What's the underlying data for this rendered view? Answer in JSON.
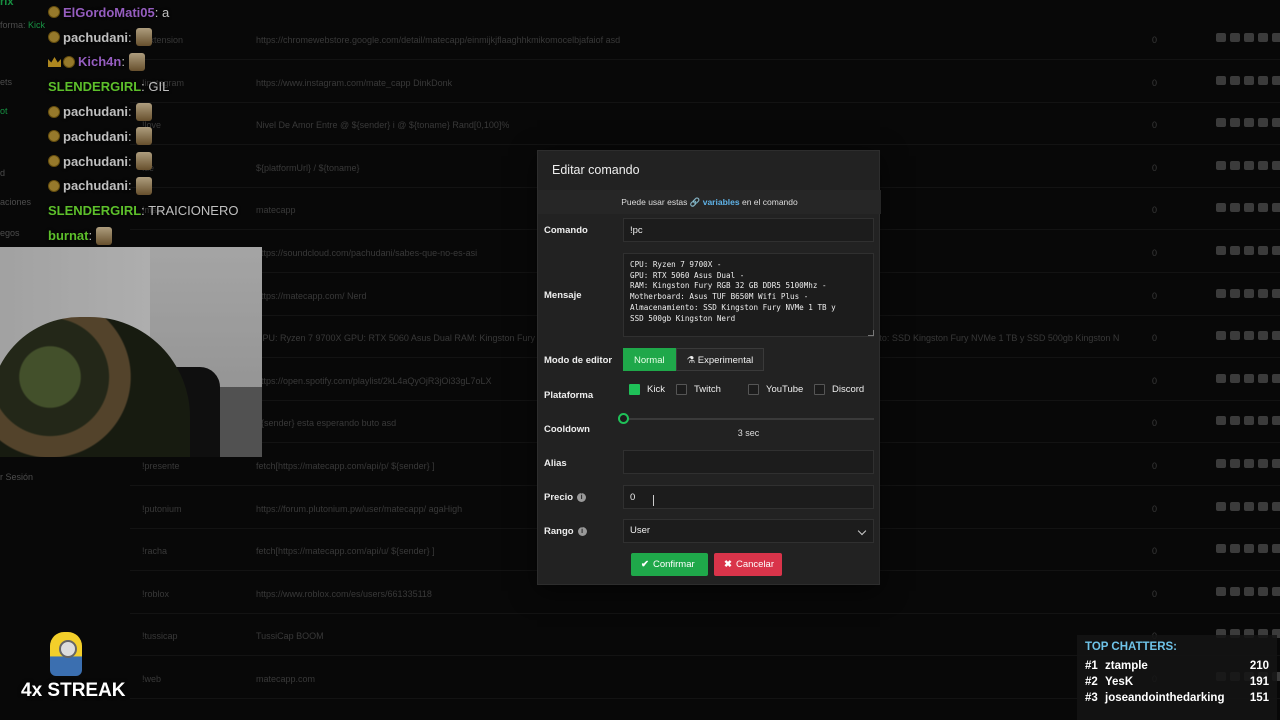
{
  "sidebar": {
    "fragments": [
      "rix",
      "forma:",
      "Kick",
      "ets",
      "ot",
      "d",
      "aciones",
      "egos",
      "r Sesión"
    ]
  },
  "commands": [
    {
      "name": "!extension",
      "message": "https://chromewebstore.google.com/detail/matecapp/einmijkjflaaghhkmikomocelbjafaiof asd",
      "count": "0"
    },
    {
      "name": "!instagram",
      "message": "https://www.instagram.com/mate_capp DinkDonk",
      "count": "0"
    },
    {
      "name": "!love",
      "message": "Nivel De Amor Entre @ ${sender} i @ ${toname} Rand[0,100]%",
      "count": "0"
    },
    {
      "name": "!tle",
      "message": "${platformUrl} / ${toname}",
      "count": "0"
    },
    {
      "name": "!mate",
      "message": "matecapp",
      "count": "0"
    },
    {
      "name": "!sc",
      "message": "https://soundcloud.com/pachudani/sabes-que-no-es-asi",
      "count": "0"
    },
    {
      "name": "!web",
      "message": "https://matecapp.com/ Nerd",
      "count": "0"
    },
    {
      "name": "!pc",
      "message": "CPU: Ryzen 7 9700X GPU: RTX 5060 Asus Dual RAM: Kingston Fury RGB 32 GB DDR5 5100Mhz Motherboard: Asus TUF B650M Wifi Plus Almacenamiento: SSD Kingston Fury NVMe 1 TB y SSD 500gb Kingston N",
      "count": "0"
    },
    {
      "name": "!spotify",
      "message": "https://open.spotify.com/playlist/2kL4aQyOjR3jOi33gL7oLX",
      "count": "0"
    },
    {
      "name": "!buto",
      "message": "${sender} esta esperando buto asd",
      "count": "0"
    },
    {
      "name": "!presente",
      "message": "fetch[https://matecapp.com/api/p/ ${sender} ]",
      "count": "0"
    },
    {
      "name": "!putonium",
      "message": "https://forum.plutonium.pw/user/matecapp/ agaHigh",
      "count": "0"
    },
    {
      "name": "!racha",
      "message": "fetch[https://matecapp.com/api/u/ ${sender} ]",
      "count": "0"
    },
    {
      "name": "!roblox",
      "message": "https://www.roblox.com/es/users/661335118",
      "count": "0"
    },
    {
      "name": "!tussicap",
      "message": "TussiCap BOOM",
      "count": "0"
    },
    {
      "name": "!web",
      "message": "matecapp.com",
      "count": "0"
    }
  ],
  "chat": [
    {
      "user": "ElGordoMati05",
      "color": "#c77dff",
      "message": ": a",
      "badge": "coin",
      "emote": false
    },
    {
      "user": "pachudani",
      "color": "#ffffff",
      "message": ":",
      "badge": "coin",
      "emote": true
    },
    {
      "user": "Kich4n",
      "color": "#c77dff",
      "message": ":",
      "badge": "crown",
      "emote": true
    },
    {
      "user": "SLENDERGIRL",
      "color": "#7cff3a",
      "message": ": GIL",
      "badge": "none",
      "emote": false
    },
    {
      "user": "pachudani",
      "color": "#ffffff",
      "message": ":",
      "badge": "coin",
      "emote": true
    },
    {
      "user": "pachudani",
      "color": "#ffffff",
      "message": ":",
      "badge": "coin",
      "emote": true
    },
    {
      "user": "pachudani",
      "color": "#ffffff",
      "message": ":",
      "badge": "coin",
      "emote": true
    },
    {
      "user": "pachudani",
      "color": "#ffffff",
      "message": ":",
      "badge": "coin",
      "emote": true
    },
    {
      "user": "SLENDERGIRL",
      "color": "#7cff3a",
      "message": ": TRAICIONERO",
      "badge": "none",
      "emote": false
    },
    {
      "user": "burnat",
      "color": "#7cff3a",
      "message": ":",
      "badge": "none",
      "emote": true
    }
  ],
  "streak": {
    "label": "4x STREAK"
  },
  "top_chatters": {
    "title": "TOP CHATTERS:",
    "rows": [
      {
        "rank": "#1",
        "name": "ztample",
        "count": "210"
      },
      {
        "rank": "#2",
        "name": "YesK",
        "count": "191"
      },
      {
        "rank": "#3",
        "name": "joseandointhedarking",
        "count": "151"
      }
    ]
  },
  "modal": {
    "title": "Editar comando",
    "info_prefix": "Puede usar estas",
    "info_link": "🔗 variables",
    "info_suffix": "en el comando",
    "labels": {
      "command": "Comando",
      "message": "Mensaje",
      "editor_mode": "Modo de editor",
      "platform": "Plataforma",
      "cooldown": "Cooldown",
      "alias": "Alias",
      "price": "Precio",
      "rank": "Rango"
    },
    "command_value": "!pc",
    "message_value": "CPU: Ryzen 7 9700X -\nGPU: RTX 5060 Asus Dual -\nRAM: Kingston Fury RGB 32 GB DDR5 5100Mhz -\nMotherboard: Asus TUF B650M Wifi Plus -\nAlmacenamiento: SSD Kingston Fury NVMe 1 TB y\nSSD 500gb Kingston Nerd",
    "editor_modes": [
      "Normal",
      "⚗ Experimental"
    ],
    "editor_mode_selected": "Normal",
    "platforms": [
      {
        "name": "Kick",
        "checked": true
      },
      {
        "name": "Twitch",
        "checked": false
      },
      {
        "name": "YouTube",
        "checked": false
      },
      {
        "name": "Discord",
        "checked": false
      }
    ],
    "cooldown_value": 3,
    "cooldown_text": "3 sec",
    "alias_value": "",
    "price_value": "0",
    "rank_value": "User",
    "confirm_label": "Confirmar",
    "cancel_label": "Cancelar",
    "colors": {
      "accent": "#1fa84a",
      "danger": "#d9344a",
      "link": "#5fb3e8"
    }
  }
}
